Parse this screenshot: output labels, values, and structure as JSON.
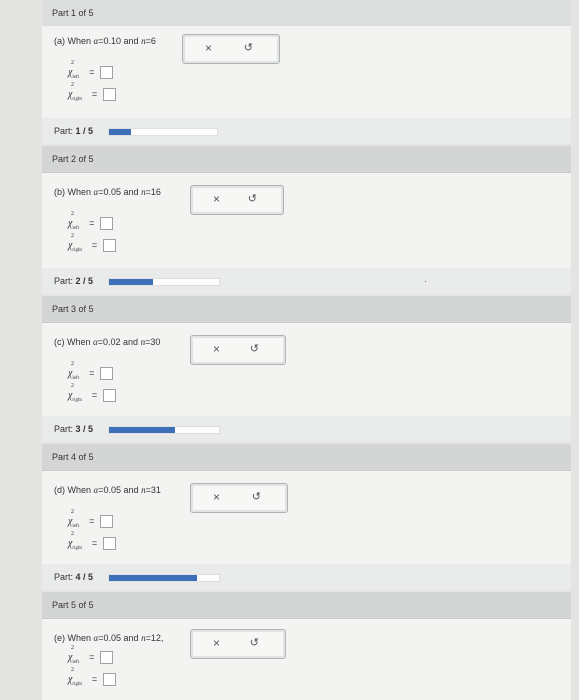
{
  "parts": [
    {
      "header": "Part 1 of 5",
      "prefix": "(a) When ",
      "alpha": "0.10",
      "n": "6",
      "suffix": "",
      "chi_left": "left",
      "chi_right": "right"
    },
    {
      "header": "Part 2 of 5",
      "prefix": "(b) When ",
      "alpha": "0.05",
      "n": "16",
      "suffix": "",
      "chi_left": "left",
      "chi_right": "right"
    },
    {
      "header": "Part 3 of 5",
      "prefix": "(c) When ",
      "alpha": "0.02",
      "n": "30",
      "suffix": "",
      "chi_left": "left",
      "chi_right": "right"
    },
    {
      "header": "Part 4 of 5",
      "prefix": "(d) When ",
      "alpha": "0.05",
      "n": "31",
      "suffix": "",
      "chi_left": "left",
      "chi_right": "right"
    },
    {
      "header": "Part 5 of 5",
      "prefix": "(e) When ",
      "alpha": "0.05",
      "n": "12",
      "suffix": ",",
      "chi_left": "left",
      "chi_right": "right"
    }
  ],
  "progress": [
    {
      "label": "Part:",
      "value": "1 / 5",
      "fraction": 0.2
    },
    {
      "label": "Part:",
      "value": "2 / 5",
      "fraction": 0.4
    },
    {
      "label": "Part:",
      "value": "3 / 5",
      "fraction": 0.6
    },
    {
      "label": "Part:",
      "value": "4 / 5",
      "fraction": 0.8
    }
  ],
  "symbols": {
    "alpha": "α",
    "n": "n",
    "equals": "=",
    "and": " and ",
    "chi": "χ",
    "sq": "2",
    "close": "×",
    "undo": "↺"
  },
  "colors": {
    "accent": "#3d6eb8",
    "header_bg": "#d4d6d6",
    "body_bg": "#f3f3f2"
  }
}
